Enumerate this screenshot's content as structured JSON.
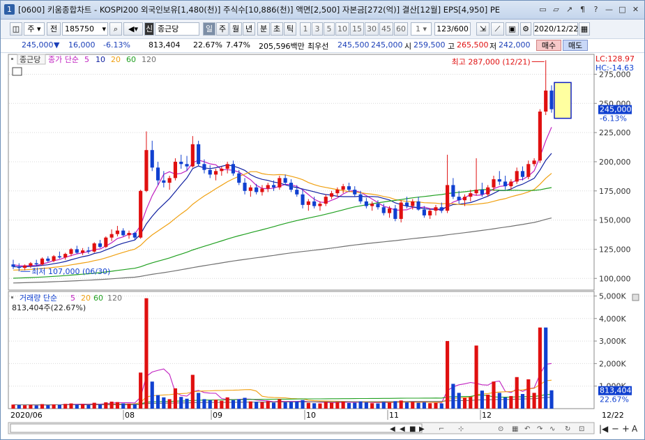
{
  "titlebar": {
    "badge": "1",
    "text": "[0600] 키움종합차트 - KOSPI200 외국인보유[1,480(천)] 주식수[10,886(천)] 액면[2,500] 자본금[272(억)] 결산[12월] EPS[4,950] PE",
    "buttons": [
      "▭",
      "▱",
      "↗",
      "¶",
      "?",
      "—",
      "□",
      "✕"
    ]
  },
  "toolbar": {
    "period_label": "주",
    "prev_label": "전",
    "code": "185750",
    "stock_badge": "신",
    "stock_name": "종근당",
    "periods": [
      "일",
      "주",
      "월",
      "년",
      "분",
      "초",
      "틱"
    ],
    "active_period": "일",
    "minutes": [
      "1",
      "3",
      "5",
      "10",
      "15",
      "30",
      "45",
      "60"
    ],
    "count_value": "1",
    "count_display": "123/600",
    "date": "2020/12/22"
  },
  "quote": {
    "price": "245,000",
    "arrow": "▼",
    "change": "16,000",
    "change_pct": "-6.13%",
    "volume": "813,404",
    "volume_pct": "22.67%",
    "turnover": "7.47%",
    "amount": "205,596백만",
    "best_label": "최우선",
    "best_ask": "245,500",
    "best_bid": "245,000",
    "open_label": "시",
    "open": "259,500",
    "high_label": "고",
    "high": "265,500",
    "low_label": "저",
    "low": "242,000",
    "buy_label": "매수",
    "sell_label": "매도"
  },
  "price_panel": {
    "stock_tag": "종근당",
    "ma_title": "종가 단순",
    "ma_periods": [
      "5",
      "10",
      "20",
      "60",
      "120"
    ],
    "ma_colors": [
      "#c020c0",
      "#1020a0",
      "#f0a010",
      "#20a020",
      "#707070"
    ],
    "lc_label": "LC:128.97",
    "hc_label": "HC:-14.63",
    "current_price": "245,000",
    "current_pct": "-6.13%",
    "high_annot": "최고 287,000 (12/21)",
    "low_annot": "최저 107,000 (06/30)"
  },
  "volume_panel": {
    "title": "거래량 단순",
    "ma_periods": [
      "5",
      "20",
      "60",
      "120"
    ],
    "current": "813,404주(22.67%)",
    "current_value": "813,404",
    "current_pct": "22.67%"
  },
  "date_axis": {
    "labels": [
      "2020/06",
      "08",
      "09",
      "10",
      "11",
      "12",
      "12/22"
    ]
  },
  "colors": {
    "up": "#e01010",
    "down": "#1040d0",
    "grid": "#d8d8d8"
  },
  "chart_data": {
    "type": "candlestick",
    "price_axis": {
      "ticks": [
        "275,000",
        "250,000",
        "225,000",
        "200,000",
        "175,000",
        "150,000",
        "125,000",
        "100,000"
      ],
      "tick_values": [
        275000,
        250000,
        225000,
        200000,
        175000,
        150000,
        125000,
        100000
      ],
      "range": [
        90000,
        292000
      ]
    },
    "volume_axis": {
      "ticks": [
        "5,000K",
        "4,000K",
        "3,000K",
        "2,000K",
        "1,000K"
      ],
      "tick_values": [
        5000,
        4000,
        3000,
        2000,
        1000
      ],
      "range": [
        0,
        5200
      ]
    },
    "candles": [
      [
        112000,
        116000,
        108000,
        110000
      ],
      [
        110000,
        113000,
        106000,
        109000
      ],
      [
        109000,
        112000,
        107000,
        111000
      ],
      [
        111000,
        114000,
        109000,
        113000
      ],
      [
        113000,
        116000,
        111000,
        112000
      ],
      [
        112000,
        118000,
        111000,
        117000
      ],
      [
        117000,
        119000,
        114000,
        115000
      ],
      [
        115000,
        120000,
        114000,
        119000
      ],
      [
        119000,
        123000,
        117000,
        118000
      ],
      [
        118000,
        122000,
        116000,
        121000
      ],
      [
        121000,
        126000,
        119000,
        125000
      ],
      [
        125000,
        128000,
        121000,
        122000
      ],
      [
        122000,
        126000,
        120000,
        124000
      ],
      [
        124000,
        127000,
        121000,
        123000
      ],
      [
        123000,
        131000,
        122000,
        130000
      ],
      [
        130000,
        133000,
        126000,
        127000
      ],
      [
        127000,
        136000,
        126000,
        135000
      ],
      [
        135000,
        142000,
        132000,
        138000
      ],
      [
        138000,
        145000,
        136000,
        141000
      ],
      [
        141000,
        143000,
        136000,
        137000
      ],
      [
        137000,
        141000,
        134000,
        139000
      ],
      [
        139000,
        140000,
        133000,
        135000
      ],
      [
        135000,
        176000,
        134000,
        175000
      ],
      [
        175000,
        226000,
        174000,
        210000
      ],
      [
        210000,
        218000,
        192000,
        195000
      ],
      [
        195000,
        200000,
        180000,
        184000
      ],
      [
        184000,
        192000,
        178000,
        182000
      ],
      [
        182000,
        188000,
        176000,
        186000
      ],
      [
        186000,
        203000,
        184000,
        200000
      ],
      [
        200000,
        206000,
        194000,
        198000
      ],
      [
        198000,
        205000,
        192000,
        196000
      ],
      [
        196000,
        222000,
        195000,
        215000
      ],
      [
        215000,
        218000,
        196000,
        198000
      ],
      [
        198000,
        202000,
        190000,
        193000
      ],
      [
        193000,
        197000,
        186000,
        189000
      ],
      [
        189000,
        194000,
        184000,
        192000
      ],
      [
        192000,
        196000,
        188000,
        194000
      ],
      [
        194000,
        200000,
        190000,
        198000
      ],
      [
        198000,
        201000,
        188000,
        190000
      ],
      [
        190000,
        193000,
        180000,
        182000
      ],
      [
        182000,
        186000,
        172000,
        175000
      ],
      [
        175000,
        180000,
        170000,
        178000
      ],
      [
        178000,
        181000,
        172000,
        174000
      ],
      [
        174000,
        180000,
        171000,
        177000
      ],
      [
        177000,
        182000,
        174000,
        180000
      ],
      [
        180000,
        184000,
        175000,
        178000
      ],
      [
        178000,
        188000,
        176000,
        186000
      ],
      [
        186000,
        189000,
        180000,
        182000
      ],
      [
        182000,
        185000,
        174000,
        176000
      ],
      [
        176000,
        180000,
        170000,
        172000
      ],
      [
        172000,
        176000,
        160000,
        163000
      ],
      [
        163000,
        168000,
        158000,
        166000
      ],
      [
        166000,
        170000,
        160000,
        162000
      ],
      [
        162000,
        166000,
        158000,
        164000
      ],
      [
        164000,
        172000,
        162000,
        170000
      ],
      [
        170000,
        175000,
        168000,
        173000
      ],
      [
        173000,
        178000,
        170000,
        176000
      ],
      [
        176000,
        181000,
        173000,
        179000
      ],
      [
        179000,
        182000,
        174000,
        176000
      ],
      [
        176000,
        179000,
        170000,
        172000
      ],
      [
        172000,
        175000,
        164000,
        166000
      ],
      [
        166000,
        169000,
        160000,
        162000
      ],
      [
        162000,
        166000,
        158000,
        164000
      ],
      [
        164000,
        167000,
        159000,
        161000
      ],
      [
        161000,
        164000,
        154000,
        156000
      ],
      [
        156000,
        162000,
        152000,
        160000
      ],
      [
        160000,
        163000,
        149000,
        151000
      ],
      [
        151000,
        167000,
        148000,
        165000
      ],
      [
        165000,
        170000,
        160000,
        162000
      ],
      [
        162000,
        168000,
        159000,
        166000
      ],
      [
        166000,
        170000,
        158000,
        159000
      ],
      [
        159000,
        162000,
        152000,
        154000
      ],
      [
        154000,
        160000,
        151000,
        158000
      ],
      [
        158000,
        163000,
        154000,
        161000
      ],
      [
        161000,
        165000,
        156000,
        158000
      ],
      [
        158000,
        206000,
        156000,
        180000
      ],
      [
        180000,
        186000,
        168000,
        170000
      ],
      [
        170000,
        175000,
        164000,
        167000
      ],
      [
        167000,
        172000,
        162000,
        170000
      ],
      [
        170000,
        176000,
        166000,
        173000
      ],
      [
        173000,
        203000,
        171000,
        176000
      ],
      [
        176000,
        182000,
        170000,
        172000
      ],
      [
        172000,
        180000,
        170000,
        178000
      ],
      [
        178000,
        188000,
        175000,
        185000
      ],
      [
        185000,
        192000,
        180000,
        183000
      ],
      [
        183000,
        188000,
        176000,
        179000
      ],
      [
        179000,
        185000,
        176000,
        183000
      ],
      [
        183000,
        195000,
        181000,
        192000
      ],
      [
        192000,
        196000,
        184000,
        187000
      ],
      [
        187000,
        201000,
        185000,
        198000
      ],
      [
        198000,
        203000,
        196000,
        201000
      ],
      [
        201000,
        245000,
        199000,
        243000
      ],
      [
        243000,
        287000,
        240000,
        261000
      ],
      [
        261000,
        265500,
        242000,
        245000
      ]
    ],
    "volumes": [
      [
        180,
        1
      ],
      [
        160,
        0
      ],
      [
        150,
        1
      ],
      [
        170,
        1
      ],
      [
        140,
        0
      ],
      [
        200,
        1
      ],
      [
        150,
        0
      ],
      [
        190,
        1
      ],
      [
        170,
        0
      ],
      [
        210,
        1
      ],
      [
        230,
        1
      ],
      [
        180,
        0
      ],
      [
        200,
        1
      ],
      [
        170,
        0
      ],
      [
        260,
        1
      ],
      [
        190,
        0
      ],
      [
        280,
        1
      ],
      [
        310,
        1
      ],
      [
        290,
        1
      ],
      [
        230,
        0
      ],
      [
        220,
        1
      ],
      [
        200,
        0
      ],
      [
        1600,
        1
      ],
      [
        4900,
        1
      ],
      [
        1200,
        0
      ],
      [
        600,
        0
      ],
      [
        500,
        0
      ],
      [
        420,
        1
      ],
      [
        900,
        1
      ],
      [
        520,
        0
      ],
      [
        440,
        0
      ],
      [
        1500,
        1
      ],
      [
        700,
        0
      ],
      [
        420,
        0
      ],
      [
        380,
        0
      ],
      [
        400,
        1
      ],
      [
        350,
        1
      ],
      [
        500,
        1
      ],
      [
        380,
        0
      ],
      [
        420,
        0
      ],
      [
        480,
        0
      ],
      [
        320,
        1
      ],
      [
        300,
        0
      ],
      [
        290,
        1
      ],
      [
        330,
        1
      ],
      [
        270,
        0
      ],
      [
        420,
        1
      ],
      [
        280,
        0
      ],
      [
        300,
        0
      ],
      [
        320,
        0
      ],
      [
        380,
        0
      ],
      [
        260,
        1
      ],
      [
        240,
        0
      ],
      [
        230,
        1
      ],
      [
        300,
        1
      ],
      [
        270,
        1
      ],
      [
        290,
        1
      ],
      [
        310,
        1
      ],
      [
        250,
        0
      ],
      [
        260,
        0
      ],
      [
        320,
        0
      ],
      [
        280,
        0
      ],
      [
        240,
        1
      ],
      [
        230,
        0
      ],
      [
        290,
        0
      ],
      [
        270,
        1
      ],
      [
        330,
        0
      ],
      [
        360,
        1
      ],
      [
        280,
        0
      ],
      [
        300,
        1
      ],
      [
        260,
        0
      ],
      [
        280,
        0
      ],
      [
        240,
        1
      ],
      [
        260,
        1
      ],
      [
        230,
        0
      ],
      [
        3000,
        1
      ],
      [
        1100,
        0
      ],
      [
        700,
        0
      ],
      [
        480,
        1
      ],
      [
        520,
        1
      ],
      [
        2800,
        1
      ],
      [
        800,
        0
      ],
      [
        620,
        1
      ],
      [
        1200,
        1
      ],
      [
        700,
        0
      ],
      [
        500,
        0
      ],
      [
        560,
        1
      ],
      [
        1400,
        1
      ],
      [
        650,
        0
      ],
      [
        1300,
        1
      ],
      [
        700,
        1
      ],
      [
        3600,
        1
      ],
      [
        3600,
        0
      ],
      [
        813,
        0
      ]
    ]
  }
}
